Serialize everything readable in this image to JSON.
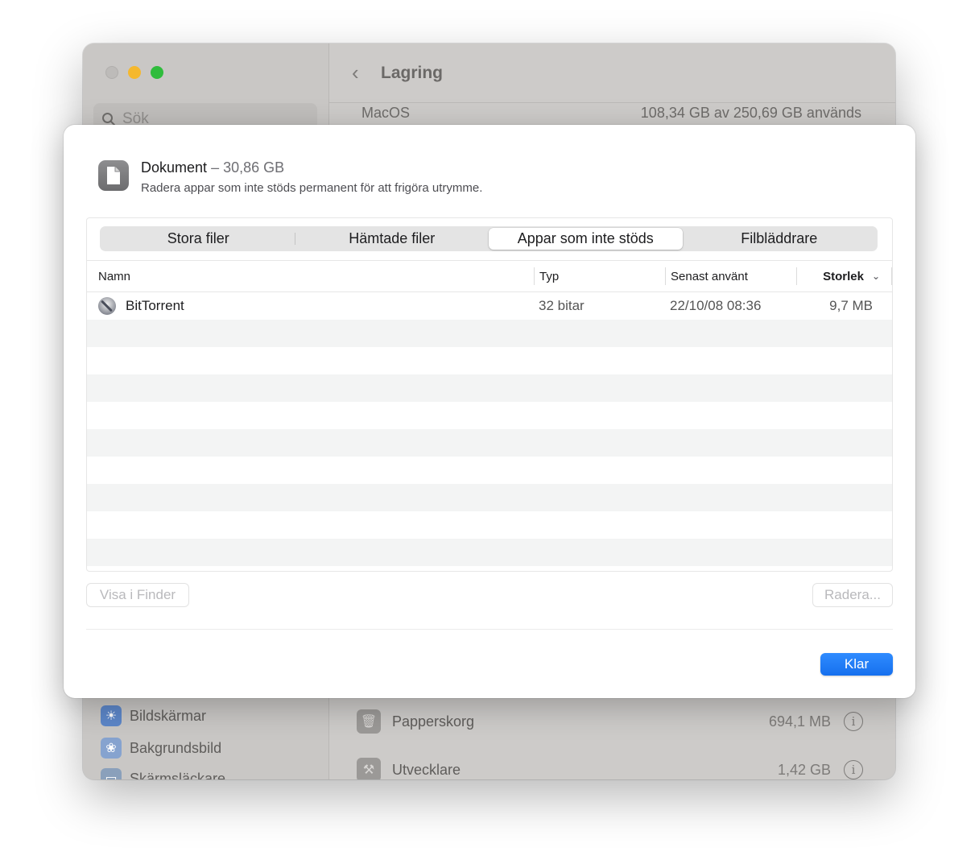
{
  "background_window": {
    "search_placeholder": "Sök",
    "title": "Lagring",
    "macos_label": "MacOS",
    "macos_usage": "108,34 GB av 250,69 GB används",
    "sidebar_items": [
      {
        "label": "Bildskärmar",
        "icon": "display-icon",
        "color": "#3b82f6"
      },
      {
        "label": "Bakgrundsbild",
        "icon": "wallpaper-icon",
        "color": "#60a5fa"
      },
      {
        "label": "Skärmsläckare",
        "icon": "screensaver-icon",
        "color": "#8aa4c4"
      }
    ],
    "storage_rows": [
      {
        "name": "Papperskorg",
        "size": "694,1 MB",
        "icon": "trash-icon"
      },
      {
        "name": "Utvecklare",
        "size": "1,42 GB",
        "icon": "hammer-icon"
      }
    ]
  },
  "sheet": {
    "title": "Dokument",
    "title_separator": "–",
    "title_size": "30,86 GB",
    "subtitle": "Radera appar som inte stöds permanent för att frigöra utrymme.",
    "tabs": [
      {
        "label": "Stora filer",
        "active": false
      },
      {
        "label": "Hämtade filer",
        "active": false
      },
      {
        "label": "Appar som inte stöds",
        "active": true
      },
      {
        "label": "Filbläddrare",
        "active": false
      }
    ],
    "columns": {
      "name": "Namn",
      "type": "Typ",
      "last_used": "Senast använt",
      "size": "Storlek"
    },
    "rows": [
      {
        "name": "BitTorrent",
        "type": "32 bitar",
        "last_used": "22/10/08 08:36",
        "size": "9,7 MB",
        "icon": "bittorrent-app-icon"
      }
    ],
    "buttons": {
      "show_in_finder": "Visa i Finder",
      "delete": "Radera...",
      "done": "Klar"
    }
  }
}
